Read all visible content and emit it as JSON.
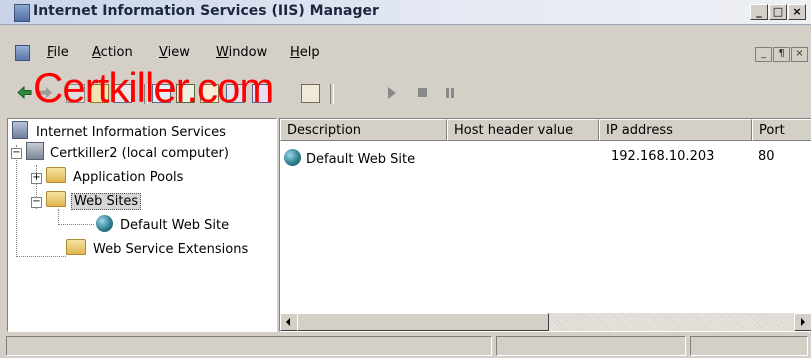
{
  "window": {
    "title": "Internet Information Services (IIS) Manager",
    "controls": [
      "_",
      "□",
      "×"
    ]
  },
  "menubar": {
    "items": [
      {
        "accel": "F",
        "rest": "ile"
      },
      {
        "accel": "A",
        "rest": "ction"
      },
      {
        "accel": "V",
        "rest": "iew"
      },
      {
        "accel": "W",
        "rest": "indow"
      },
      {
        "accel": "H",
        "rest": "elp"
      }
    ],
    "mdi_controls": [
      "_",
      "¶",
      "×"
    ]
  },
  "watermark": "Certkiller.com",
  "tree": {
    "root": "Internet Information Services",
    "computer": "Certkiller2 (local computer)",
    "app_pools": "Application Pools",
    "web_sites": "Web Sites",
    "default_site": "Default Web Site",
    "extensions": "Web Service Extensions"
  },
  "list": {
    "columns": [
      "Description",
      "Host header value",
      "IP address",
      "Port"
    ],
    "rows": [
      {
        "description": "Default Web Site",
        "host_header": "",
        "ip_address": "192.168.10.203",
        "port": "80"
      }
    ]
  },
  "icons": {
    "back": "back-arrow-icon",
    "forward": "forward-arrow-icon",
    "folder": "folder-icon",
    "globe": "globe-icon",
    "computer": "computer-icon"
  }
}
